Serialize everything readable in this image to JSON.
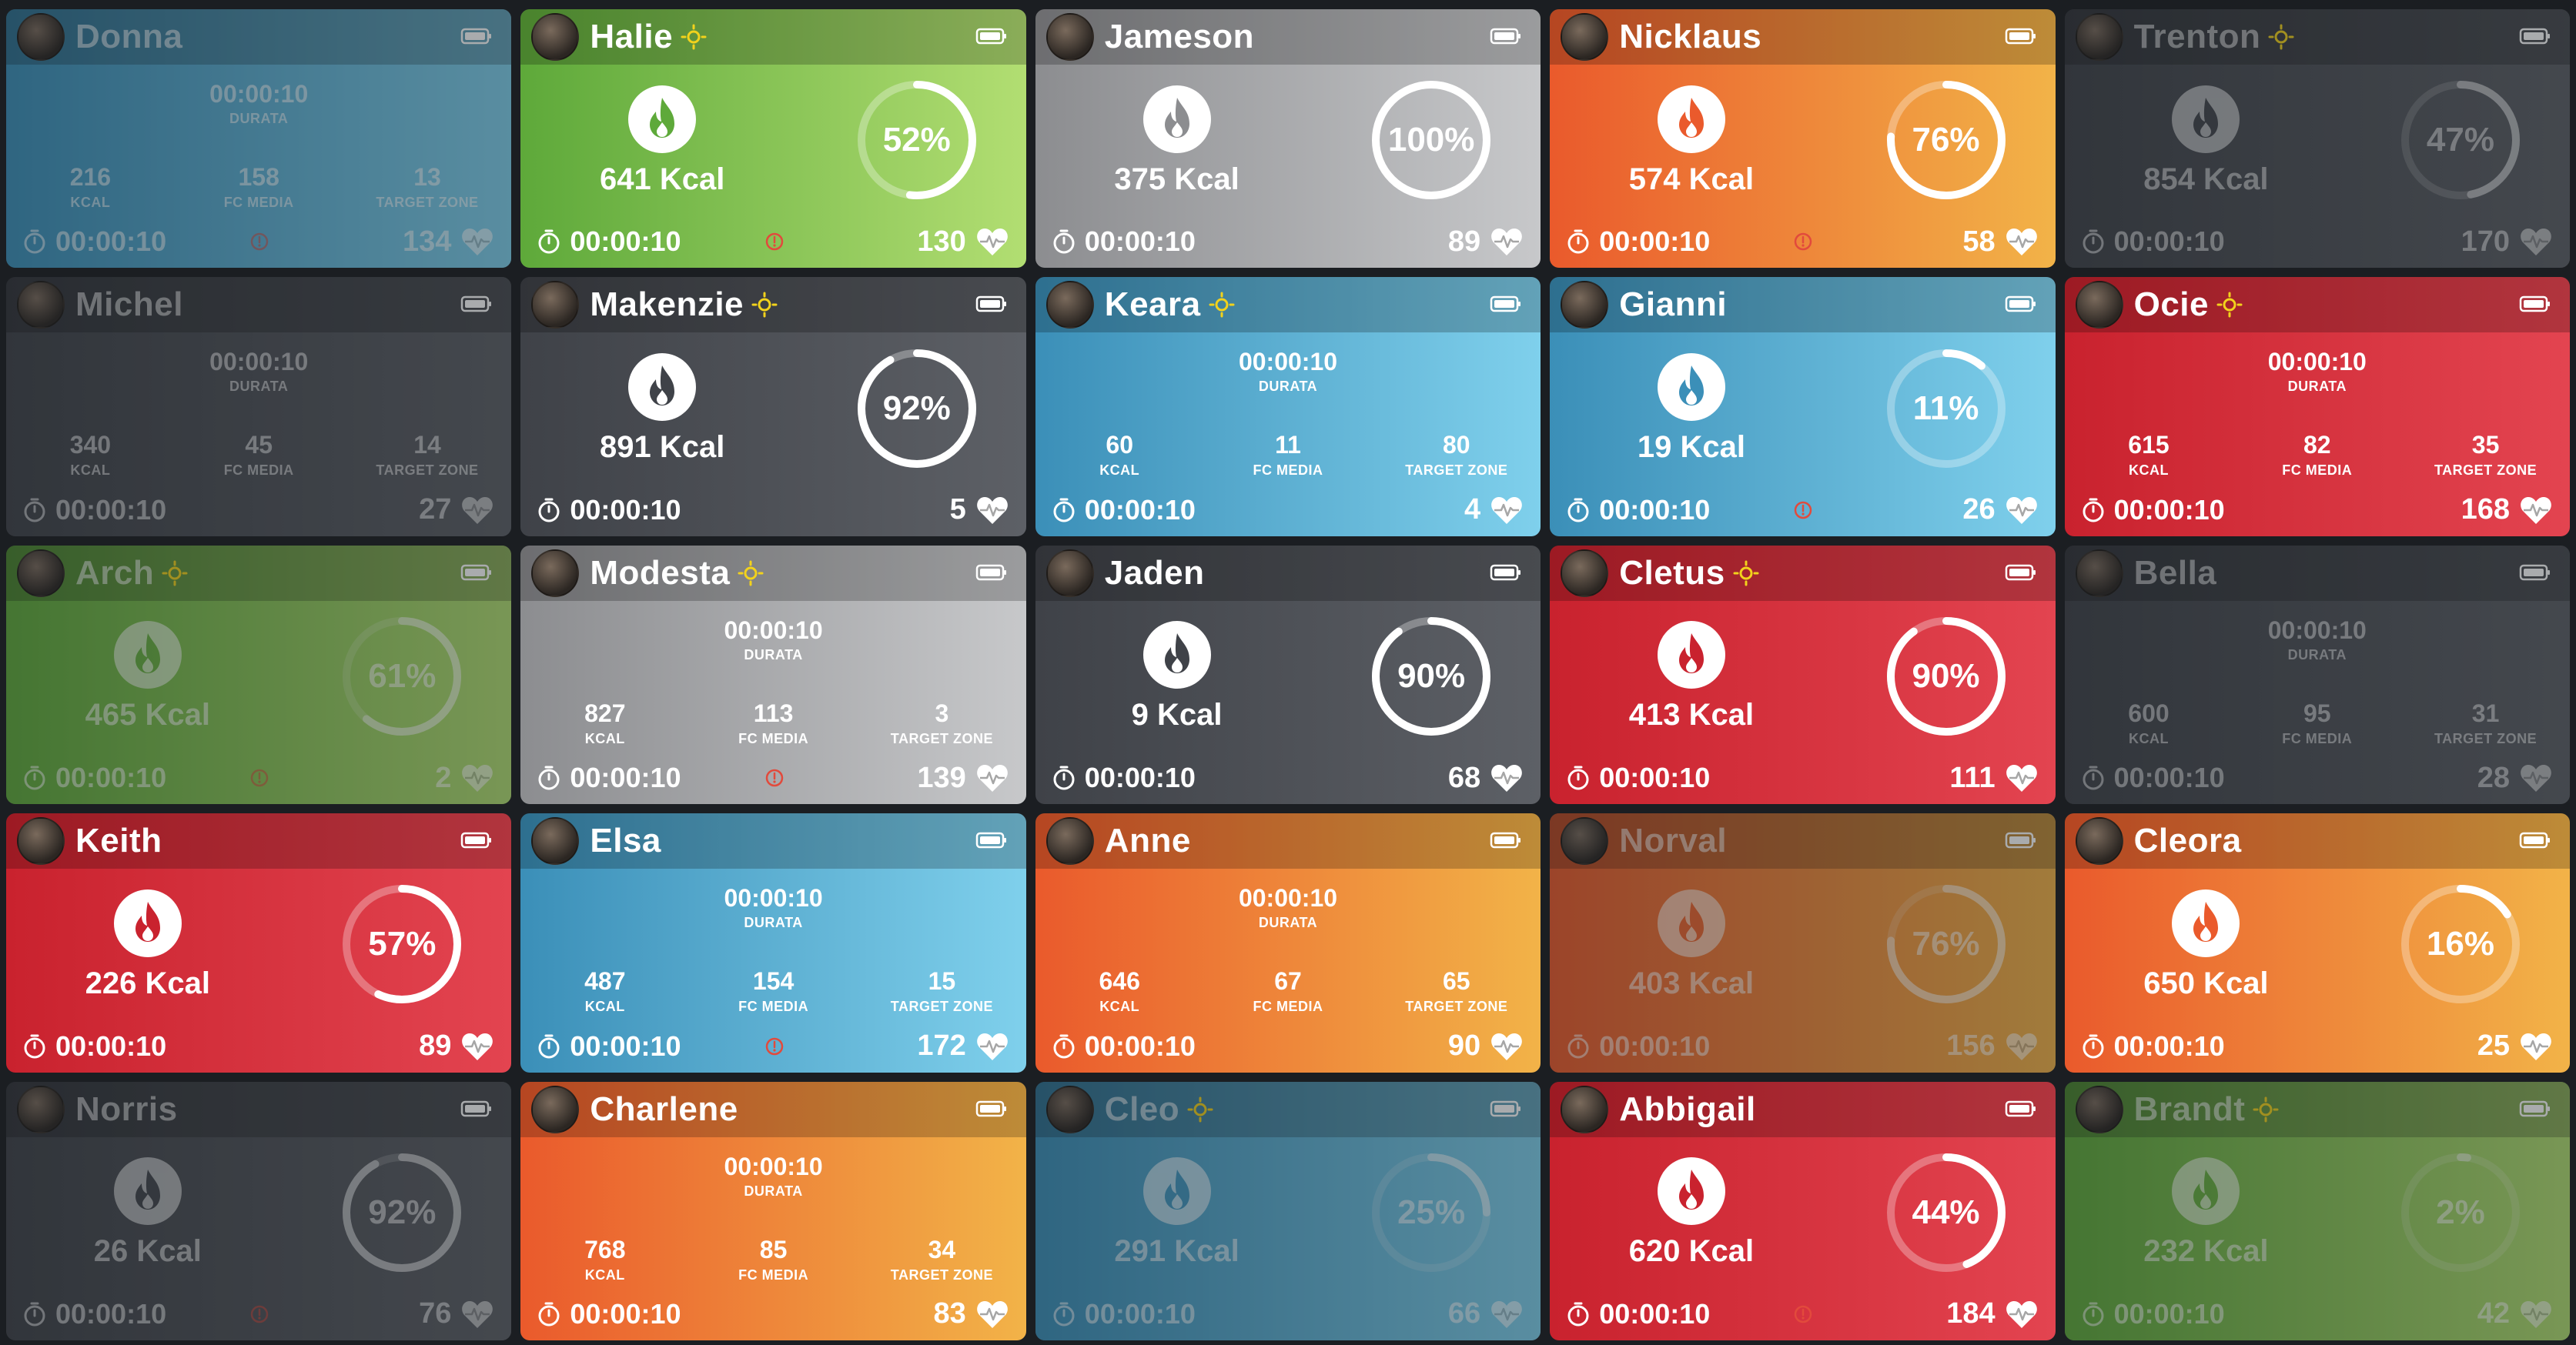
{
  "labels": {
    "duration": "DURATA",
    "kcal": "KCAL",
    "hr_avg": "FC MEDIA",
    "target_zone": "TARGET ZONE"
  },
  "colors": {
    "blue": "#4fa6cc",
    "green": "#7cbf4c",
    "gray": "#a9aaac",
    "orange": "#ee8a3a",
    "dark": "#4a4d52",
    "red": "#d6303b",
    "star": "#f2d21c",
    "alert": "#e24a3c"
  },
  "tiles": [
    {
      "name": "Donna",
      "color": "blue",
      "dim": true,
      "star": false,
      "view": "stats",
      "duration": "00:00:10",
      "kcal": "216",
      "hr_avg": "158",
      "target_zone": "13",
      "time": "00:00:10",
      "hr": "134",
      "alert": true
    },
    {
      "name": "Halie",
      "color": "green",
      "dim": false,
      "star": true,
      "view": "ring",
      "kcal_label": "641 Kcal",
      "percent": 52,
      "percent_label": "52%",
      "time": "00:00:10",
      "hr": "130",
      "alert": true
    },
    {
      "name": "Jameson",
      "color": "gray",
      "dim": false,
      "star": false,
      "view": "ring",
      "kcal_label": "375 Kcal",
      "percent": 100,
      "percent_label": "100%",
      "time": "00:00:10",
      "hr": "89",
      "alert": false
    },
    {
      "name": "Nicklaus",
      "color": "orange",
      "dim": false,
      "star": false,
      "view": "ring",
      "kcal_label": "574 Kcal",
      "percent": 76,
      "percent_label": "76%",
      "time": "00:00:10",
      "hr": "58",
      "alert": true
    },
    {
      "name": "Trenton",
      "color": "dark",
      "dim": true,
      "star": true,
      "view": "ring",
      "kcal_label": "854 Kcal",
      "percent": 47,
      "percent_label": "47%",
      "time": "00:00:10",
      "hr": "170",
      "alert": false
    },
    {
      "name": "Michel",
      "color": "dark",
      "dim": true,
      "star": false,
      "view": "stats",
      "duration": "00:00:10",
      "kcal": "340",
      "hr_avg": "45",
      "target_zone": "14",
      "time": "00:00:10",
      "hr": "27",
      "alert": false
    },
    {
      "name": "Makenzie",
      "color": "dark",
      "dim": false,
      "star": true,
      "view": "ring",
      "kcal_label": "891 Kcal",
      "percent": 92,
      "percent_label": "92%",
      "time": "00:00:10",
      "hr": "5",
      "alert": false
    },
    {
      "name": "Keara",
      "color": "blue",
      "dim": false,
      "star": true,
      "view": "stats",
      "duration": "00:00:10",
      "kcal": "60",
      "hr_avg": "11",
      "target_zone": "80",
      "time": "00:00:10",
      "hr": "4",
      "alert": false
    },
    {
      "name": "Gianni",
      "color": "blue",
      "dim": false,
      "star": false,
      "view": "ring",
      "kcal_label": "19 Kcal",
      "percent": 11,
      "percent_label": "11%",
      "time": "00:00:10",
      "hr": "26",
      "alert": true
    },
    {
      "name": "Ocie",
      "color": "red",
      "dim": false,
      "star": true,
      "view": "stats",
      "duration": "00:00:10",
      "kcal": "615",
      "hr_avg": "82",
      "target_zone": "35",
      "time": "00:00:10",
      "hr": "168",
      "alert": false
    },
    {
      "name": "Arch",
      "color": "green",
      "dim": true,
      "star": true,
      "view": "ring",
      "kcal_label": "465 Kcal",
      "percent": 61,
      "percent_label": "61%",
      "time": "00:00:10",
      "hr": "2",
      "alert": true
    },
    {
      "name": "Modesta",
      "color": "gray",
      "dim": false,
      "star": true,
      "view": "stats",
      "duration": "00:00:10",
      "kcal": "827",
      "hr_avg": "113",
      "target_zone": "3",
      "time": "00:00:10",
      "hr": "139",
      "alert": true
    },
    {
      "name": "Jaden",
      "color": "dark",
      "dim": false,
      "star": false,
      "view": "ring",
      "kcal_label": "9 Kcal",
      "percent": 90,
      "percent_label": "90%",
      "time": "00:00:10",
      "hr": "68",
      "alert": false
    },
    {
      "name": "Cletus",
      "color": "red",
      "dim": false,
      "star": true,
      "view": "ring",
      "kcal_label": "413 Kcal",
      "percent": 90,
      "percent_label": "90%",
      "time": "00:00:10",
      "hr": "111",
      "alert": false
    },
    {
      "name": "Bella",
      "color": "dark",
      "dim": true,
      "star": false,
      "view": "stats",
      "duration": "00:00:10",
      "kcal": "600",
      "hr_avg": "95",
      "target_zone": "31",
      "time": "00:00:10",
      "hr": "28",
      "alert": false
    },
    {
      "name": "Keith",
      "color": "red",
      "dim": false,
      "star": false,
      "view": "ring",
      "kcal_label": "226 Kcal",
      "percent": 57,
      "percent_label": "57%",
      "time": "00:00:10",
      "hr": "89",
      "alert": false
    },
    {
      "name": "Elsa",
      "color": "blue",
      "dim": false,
      "star": false,
      "view": "stats",
      "duration": "00:00:10",
      "kcal": "487",
      "hr_avg": "154",
      "target_zone": "15",
      "time": "00:00:10",
      "hr": "172",
      "alert": true
    },
    {
      "name": "Anne",
      "color": "orange",
      "dim": false,
      "star": false,
      "view": "stats",
      "duration": "00:00:10",
      "kcal": "646",
      "hr_avg": "67",
      "target_zone": "65",
      "time": "00:00:10",
      "hr": "90",
      "alert": false
    },
    {
      "name": "Norval",
      "color": "orange",
      "dim": true,
      "star": false,
      "view": "ring",
      "kcal_label": "403 Kcal",
      "percent": 76,
      "percent_label": "76%",
      "time": "00:00:10",
      "hr": "156",
      "alert": false
    },
    {
      "name": "Cleora",
      "color": "orange",
      "dim": false,
      "star": false,
      "view": "ring",
      "kcal_label": "650 Kcal",
      "percent": 16,
      "percent_label": "16%",
      "time": "00:00:10",
      "hr": "25",
      "alert": false
    },
    {
      "name": "Norris",
      "color": "dark",
      "dim": true,
      "star": false,
      "view": "ring",
      "kcal_label": "26 Kcal",
      "percent": 92,
      "percent_label": "92%",
      "time": "00:00:10",
      "hr": "76",
      "alert": true
    },
    {
      "name": "Charlene",
      "color": "orange",
      "dim": false,
      "star": false,
      "view": "stats",
      "duration": "00:00:10",
      "kcal": "768",
      "hr_avg": "85",
      "target_zone": "34",
      "time": "00:00:10",
      "hr": "83",
      "alert": false
    },
    {
      "name": "Cleo",
      "color": "blue",
      "dim": true,
      "star": true,
      "view": "ring",
      "kcal_label": "291 Kcal",
      "percent": 25,
      "percent_label": "25%",
      "time": "00:00:10",
      "hr": "66",
      "alert": false
    },
    {
      "name": "Abbigail",
      "color": "red",
      "dim": false,
      "star": false,
      "view": "ring",
      "kcal_label": "620 Kcal",
      "percent": 44,
      "percent_label": "44%",
      "time": "00:00:10",
      "hr": "184",
      "alert": true
    },
    {
      "name": "Brandt",
      "color": "green",
      "dim": true,
      "star": true,
      "view": "ring",
      "kcal_label": "232 Kcal",
      "percent": 2,
      "percent_label": "2%",
      "time": "00:00:10",
      "hr": "42",
      "alert": false
    }
  ]
}
